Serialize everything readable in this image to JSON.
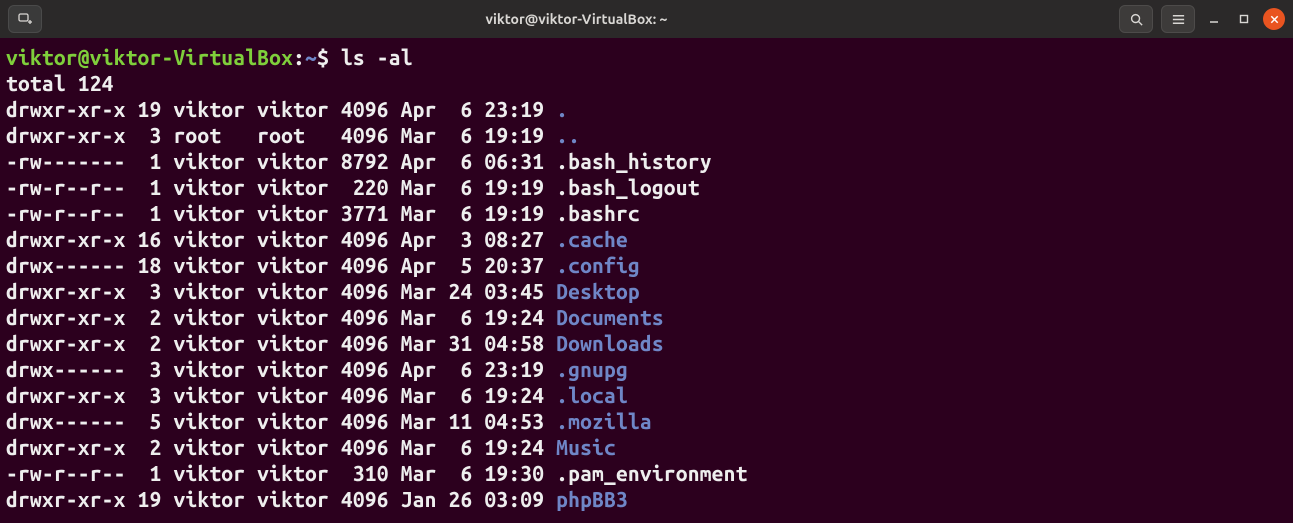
{
  "window": {
    "title": "viktor@viktor-VirtualBox: ~"
  },
  "prompt": {
    "userhost": "viktor@viktor-VirtualBox",
    "colon": ":",
    "path": "~",
    "dollar": "$ ",
    "command": "ls -al"
  },
  "total_line": "total 124",
  "rows": [
    {
      "perm": "drwxr-xr-x",
      "links": "19",
      "owner": "viktor",
      "group": "viktor",
      "size": "4096",
      "month": "Apr",
      "day": " 6",
      "time": "23:19",
      "name": ".",
      "dir": true
    },
    {
      "perm": "drwxr-xr-x",
      "links": " 3",
      "owner": "root  ",
      "group": "root  ",
      "size": "4096",
      "month": "Mar",
      "day": " 6",
      "time": "19:19",
      "name": "..",
      "dir": true
    },
    {
      "perm": "-rw-------",
      "links": " 1",
      "owner": "viktor",
      "group": "viktor",
      "size": "8792",
      "month": "Apr",
      "day": " 6",
      "time": "06:31",
      "name": ".bash_history",
      "dir": false
    },
    {
      "perm": "-rw-r--r--",
      "links": " 1",
      "owner": "viktor",
      "group": "viktor",
      "size": " 220",
      "month": "Mar",
      "day": " 6",
      "time": "19:19",
      "name": ".bash_logout",
      "dir": false
    },
    {
      "perm": "-rw-r--r--",
      "links": " 1",
      "owner": "viktor",
      "group": "viktor",
      "size": "3771",
      "month": "Mar",
      "day": " 6",
      "time": "19:19",
      "name": ".bashrc",
      "dir": false
    },
    {
      "perm": "drwxr-xr-x",
      "links": "16",
      "owner": "viktor",
      "group": "viktor",
      "size": "4096",
      "month": "Apr",
      "day": " 3",
      "time": "08:27",
      "name": ".cache",
      "dir": true
    },
    {
      "perm": "drwx------",
      "links": "18",
      "owner": "viktor",
      "group": "viktor",
      "size": "4096",
      "month": "Apr",
      "day": " 5",
      "time": "20:37",
      "name": ".config",
      "dir": true
    },
    {
      "perm": "drwxr-xr-x",
      "links": " 3",
      "owner": "viktor",
      "group": "viktor",
      "size": "4096",
      "month": "Mar",
      "day": "24",
      "time": "03:45",
      "name": "Desktop",
      "dir": true
    },
    {
      "perm": "drwxr-xr-x",
      "links": " 2",
      "owner": "viktor",
      "group": "viktor",
      "size": "4096",
      "month": "Mar",
      "day": " 6",
      "time": "19:24",
      "name": "Documents",
      "dir": true
    },
    {
      "perm": "drwxr-xr-x",
      "links": " 2",
      "owner": "viktor",
      "group": "viktor",
      "size": "4096",
      "month": "Mar",
      "day": "31",
      "time": "04:58",
      "name": "Downloads",
      "dir": true
    },
    {
      "perm": "drwx------",
      "links": " 3",
      "owner": "viktor",
      "group": "viktor",
      "size": "4096",
      "month": "Apr",
      "day": " 6",
      "time": "23:19",
      "name": ".gnupg",
      "dir": true
    },
    {
      "perm": "drwxr-xr-x",
      "links": " 3",
      "owner": "viktor",
      "group": "viktor",
      "size": "4096",
      "month": "Mar",
      "day": " 6",
      "time": "19:24",
      "name": ".local",
      "dir": true
    },
    {
      "perm": "drwx------",
      "links": " 5",
      "owner": "viktor",
      "group": "viktor",
      "size": "4096",
      "month": "Mar",
      "day": "11",
      "time": "04:53",
      "name": ".mozilla",
      "dir": true
    },
    {
      "perm": "drwxr-xr-x",
      "links": " 2",
      "owner": "viktor",
      "group": "viktor",
      "size": "4096",
      "month": "Mar",
      "day": " 6",
      "time": "19:24",
      "name": "Music",
      "dir": true
    },
    {
      "perm": "-rw-r--r--",
      "links": " 1",
      "owner": "viktor",
      "group": "viktor",
      "size": " 310",
      "month": "Mar",
      "day": " 6",
      "time": "19:30",
      "name": ".pam_environment",
      "dir": false
    },
    {
      "perm": "drwxr-xr-x",
      "links": "19",
      "owner": "viktor",
      "group": "viktor",
      "size": "4096",
      "month": "Jan",
      "day": "26",
      "time": "03:09",
      "name": "phpBB3",
      "dir": true
    }
  ]
}
